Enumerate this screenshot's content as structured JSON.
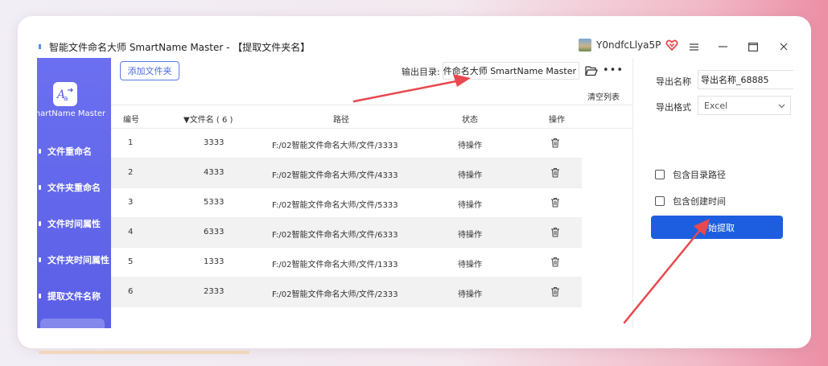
{
  "window": {
    "title": "智能文件命名大师 SmartName Master - 【提取文件夹名】",
    "user_name": "Y0ndfcLlya5P",
    "icons": [
      "vip-heart-icon",
      "menu-icon",
      "minimize-icon",
      "maximize-icon",
      "close-icon"
    ]
  },
  "sidebar": {
    "logo_text": "SmartName Master",
    "items": [
      {
        "label": "文件重命名"
      },
      {
        "label": "文件夹重命名"
      },
      {
        "label": "文件时间属性"
      },
      {
        "label": "文件夹时间属性"
      },
      {
        "label": "提取文件名称"
      }
    ]
  },
  "toolbar": {
    "add_folder": "添加文件夹",
    "output_dir_label": "输出目录:",
    "output_dir_value": "智能文件命名大师 SmartName Master",
    "clear_list": "清空列表"
  },
  "table": {
    "headers": {
      "index": "编号",
      "name": "▼文件名 ( 6 )",
      "path": "路径",
      "status": "状态",
      "action": "操作"
    },
    "rows": [
      {
        "index": "1",
        "name": "3333",
        "path": "F:/02智能文件命名大师/文件/3333",
        "status": "待操作"
      },
      {
        "index": "2",
        "name": "4333",
        "path": "F:/02智能文件命名大师/文件/4333",
        "status": "待操作"
      },
      {
        "index": "3",
        "name": "5333",
        "path": "F:/02智能文件命名大师/文件/5333",
        "status": "待操作"
      },
      {
        "index": "4",
        "name": "6333",
        "path": "F:/02智能文件命名大师/文件/6333",
        "status": "待操作"
      },
      {
        "index": "5",
        "name": "1333",
        "path": "F:/02智能文件命名大师/文件/1333",
        "status": "待操作"
      },
      {
        "index": "6",
        "name": "2333",
        "path": "F:/02智能文件命名大师/文件/2333",
        "status": "待操作"
      }
    ]
  },
  "panel": {
    "export_name_label": "导出名称",
    "export_name_value": "导出名称_68885",
    "export_format_label": "导出格式",
    "export_format_value": "Excel",
    "include_dir_path": "包含目录路径",
    "include_create_time": "包含创建时间",
    "start_button": "开始提取"
  },
  "colors": {
    "sidebar": "#5b5fe6",
    "primary_button": "#1d5ee0",
    "annotation_arrow": "#e8484e"
  }
}
